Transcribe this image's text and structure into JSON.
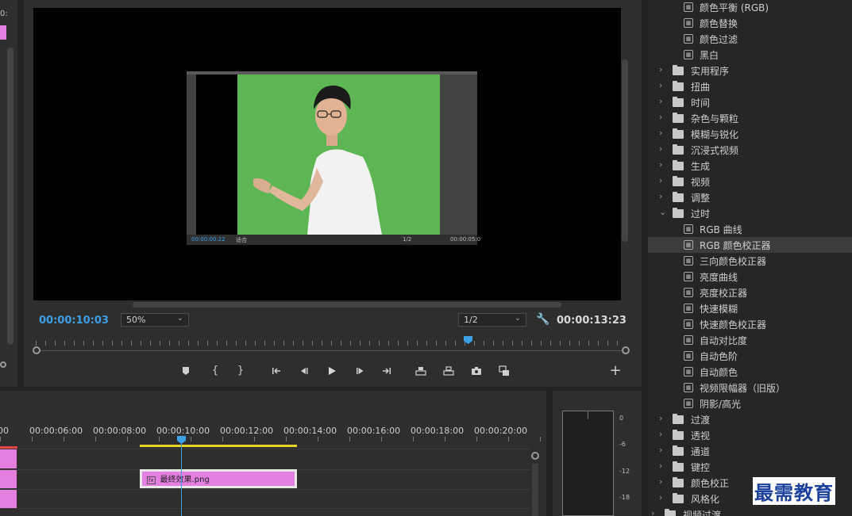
{
  "left_panel": {
    "timecode_fragment": "0:"
  },
  "monitor": {
    "current_timecode": "00:00:10:03",
    "zoom": "50%",
    "resolution": "1/2",
    "duration_timecode": "00:00:13:23",
    "inner_preview": {
      "current_timecode": "00:00:00:22",
      "zoom": "适合",
      "resolution": "1/2",
      "duration_timecode": "00:00:05:0"
    }
  },
  "transport_controls": [
    {
      "name": "add-marker-button",
      "icon": "marker-icon"
    },
    {
      "name": "mark-in-button",
      "icon": "mark-in-icon"
    },
    {
      "name": "mark-out-button",
      "icon": "mark-out-icon"
    },
    {
      "name": "go-to-in-button",
      "icon": "go-to-in-icon"
    },
    {
      "name": "step-back-button",
      "icon": "step-back-icon"
    },
    {
      "name": "play-button",
      "icon": "play-icon"
    },
    {
      "name": "step-forward-button",
      "icon": "step-forward-icon"
    },
    {
      "name": "go-to-out-button",
      "icon": "go-to-out-icon"
    },
    {
      "name": "lift-button",
      "icon": "lift-icon"
    },
    {
      "name": "extract-button",
      "icon": "extract-icon"
    },
    {
      "name": "export-frame-button",
      "icon": "camera-icon"
    },
    {
      "name": "compare-view-button",
      "icon": "compare-icon"
    },
    {
      "name": "add-button",
      "icon": "plus-icon"
    }
  ],
  "effects": {
    "items": [
      {
        "kind": "effect",
        "label": "颜色平衡 (RGB)"
      },
      {
        "kind": "effect",
        "label": "颜色替换"
      },
      {
        "kind": "effect",
        "label": "颜色过滤"
      },
      {
        "kind": "effect",
        "label": "黑白"
      },
      {
        "kind": "folder",
        "label": "实用程序",
        "expanded": false
      },
      {
        "kind": "folder",
        "label": "扭曲",
        "expanded": false
      },
      {
        "kind": "folder",
        "label": "时间",
        "expanded": false
      },
      {
        "kind": "folder",
        "label": "杂色与颗粒",
        "expanded": false
      },
      {
        "kind": "folder",
        "label": "模糊与锐化",
        "expanded": false
      },
      {
        "kind": "folder",
        "label": "沉浸式视频",
        "expanded": false
      },
      {
        "kind": "folder",
        "label": "生成",
        "expanded": false
      },
      {
        "kind": "folder",
        "label": "视频",
        "expanded": false
      },
      {
        "kind": "folder",
        "label": "调整",
        "expanded": false
      },
      {
        "kind": "folder",
        "label": "过时",
        "expanded": true
      },
      {
        "kind": "effect",
        "label": "RGB 曲线"
      },
      {
        "kind": "effect",
        "label": "RGB 颜色校正器",
        "selected": true
      },
      {
        "kind": "effect",
        "label": "三向颜色校正器"
      },
      {
        "kind": "effect",
        "label": "亮度曲线"
      },
      {
        "kind": "effect",
        "label": "亮度校正器"
      },
      {
        "kind": "effect",
        "label": "快速模糊"
      },
      {
        "kind": "effect",
        "label": "快速颜色校正器"
      },
      {
        "kind": "effect",
        "label": "自动对比度"
      },
      {
        "kind": "effect",
        "label": "自动色阶"
      },
      {
        "kind": "effect",
        "label": "自动颜色"
      },
      {
        "kind": "effect",
        "label": "视频限幅器（旧版）"
      },
      {
        "kind": "effect",
        "label": "阴影/高光"
      },
      {
        "kind": "folder",
        "label": "过渡",
        "expanded": false
      },
      {
        "kind": "folder",
        "label": "透视",
        "expanded": false
      },
      {
        "kind": "folder",
        "label": "通道",
        "expanded": false
      },
      {
        "kind": "folder",
        "label": "键控",
        "expanded": false
      },
      {
        "kind": "folder",
        "label": "颜色校正",
        "expanded": false
      },
      {
        "kind": "folder",
        "label": "风格化",
        "expanded": false
      },
      {
        "kind": "folder",
        "label": "视频过渡",
        "expanded": false,
        "top_level": true
      }
    ]
  },
  "timeline": {
    "ruler_labels": [
      "00",
      "00:00:06:00",
      "00:00:08:00",
      "00:00:10:00",
      "00:00:12:00",
      "00:00:14:00",
      "00:00:16:00",
      "00:00:18:00",
      "00:00:20:00"
    ],
    "clip": {
      "fx_badge": "fx",
      "name": "最终效果.png"
    }
  },
  "audio_meter": {
    "db_labels": [
      "0",
      "-6",
      "-12",
      "-18"
    ]
  },
  "watermark": "最需教育",
  "colors": {
    "accent_blue": "#3d9fe6",
    "clip_pink": "#e47fe0",
    "green_screen": "#5db553",
    "work_area_yellow": "#e6d429"
  }
}
